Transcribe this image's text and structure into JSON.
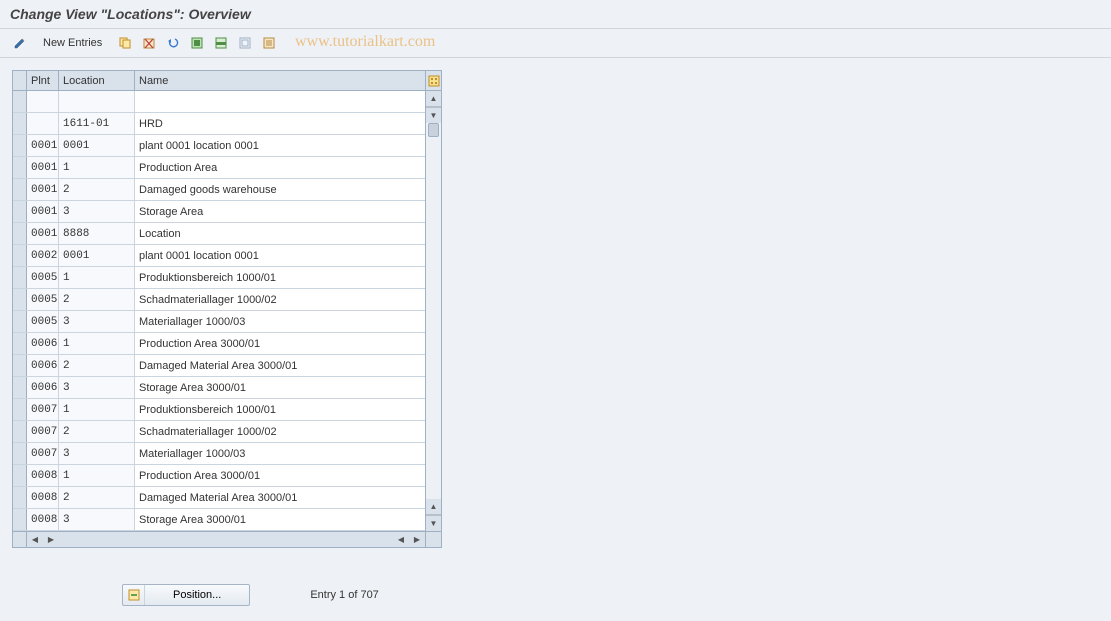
{
  "header": {
    "title": "Change View \"Locations\": Overview"
  },
  "toolbar": {
    "new_entries_label": "New Entries"
  },
  "watermark": "www.tutorialkart.com",
  "table": {
    "headers": {
      "plnt": "Plnt",
      "location": "Location",
      "name": "Name"
    },
    "rows": [
      {
        "plnt": "",
        "location": "",
        "name": ""
      },
      {
        "plnt": "",
        "location": "1611-01",
        "name": "HRD"
      },
      {
        "plnt": "0001",
        "location": "0001",
        "name": "plant 0001 location 0001"
      },
      {
        "plnt": "0001",
        "location": "1",
        "name": "Production Area"
      },
      {
        "plnt": "0001",
        "location": "2",
        "name": "Damaged goods warehouse"
      },
      {
        "plnt": "0001",
        "location": "3",
        "name": "Storage Area"
      },
      {
        "plnt": "0001",
        "location": "8888",
        "name": "Location"
      },
      {
        "plnt": "0002",
        "location": "0001",
        "name": "plant 0001 location 0001"
      },
      {
        "plnt": "0005",
        "location": "1",
        "name": "Produktionsbereich 1000/01"
      },
      {
        "plnt": "0005",
        "location": "2",
        "name": "Schadmateriallager 1000/02"
      },
      {
        "plnt": "0005",
        "location": "3",
        "name": "Materiallager 1000/03"
      },
      {
        "plnt": "0006",
        "location": "1",
        "name": "Production Area 3000/01"
      },
      {
        "plnt": "0006",
        "location": "2",
        "name": "Damaged Material Area 3000/01"
      },
      {
        "plnt": "0006",
        "location": "3",
        "name": "Storage Area  3000/01"
      },
      {
        "plnt": "0007",
        "location": "1",
        "name": "Produktionsbereich 1000/01"
      },
      {
        "plnt": "0007",
        "location": "2",
        "name": "Schadmateriallager 1000/02"
      },
      {
        "plnt": "0007",
        "location": "3",
        "name": "Materiallager 1000/03"
      },
      {
        "plnt": "0008",
        "location": "1",
        "name": "Production Area 3000/01"
      },
      {
        "plnt": "0008",
        "location": "2",
        "name": "Damaged Material Area 3000/01"
      },
      {
        "plnt": "0008",
        "location": "3",
        "name": "Storage Area  3000/01"
      }
    ]
  },
  "footer": {
    "position_label": "Position...",
    "entry_text": "Entry 1 of 707"
  }
}
